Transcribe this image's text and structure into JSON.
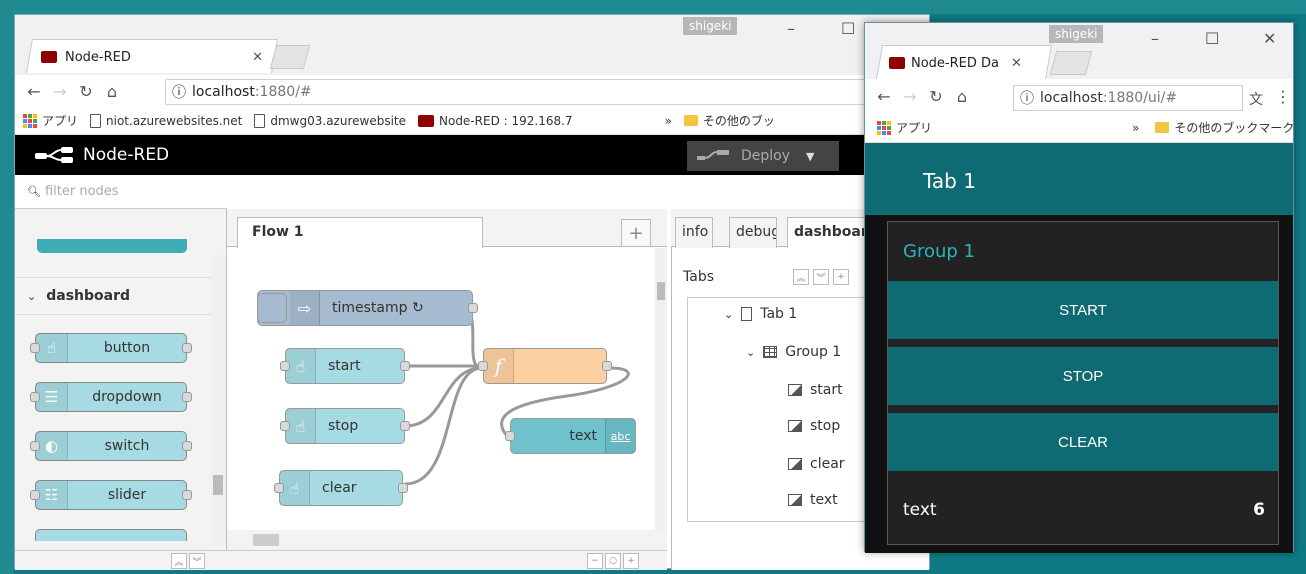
{
  "browser_main": {
    "tab_title": "Node-RED",
    "user_badge": "shigeki",
    "url_host": "localhost",
    "url_rest": ":1880/#",
    "bookmarks": [
      "アプリ",
      "niot.azurewebsites.net",
      "dmwg03.azurewebsite",
      "Node-RED : 192.168.7",
      "その他のブッ"
    ],
    "overflow": "»"
  },
  "node_red": {
    "header_title": "Node-RED",
    "deploy_label": "Deploy",
    "filter_placeholder": "filter nodes",
    "palette_category": "dashboard",
    "palette_nodes": [
      "button",
      "dropdown",
      "switch",
      "slider"
    ],
    "workspace_tab": "Flow 1",
    "flow_nodes": {
      "timestamp": "timestamp ↻",
      "start": "start",
      "stop": "stop",
      "clear": "clear",
      "text": "text",
      "text_badge": "abc",
      "function_icon": "f"
    },
    "sidebar_tabs": [
      "info",
      "debug",
      "dashboard"
    ],
    "sidebar_section": "Tabs",
    "tree": {
      "tab": "Tab 1",
      "group": "Group 1",
      "items": [
        "start",
        "stop",
        "clear",
        "text"
      ]
    }
  },
  "browser_dash": {
    "tab_title": "Node-RED Da",
    "user_badge": "shigeki",
    "url_host": "localhost",
    "url_rest": ":1880/ui/#",
    "bookmark_apps": "アプリ",
    "bookmark_other": "その他のブックマーク",
    "overflow": "»"
  },
  "dashboard": {
    "tab_title": "Tab 1",
    "group_title": "Group 1",
    "buttons": [
      "START",
      "STOP",
      "CLEAR"
    ],
    "text_label": "text",
    "text_value": "6"
  },
  "colors": {
    "desktop": "#0f7a84",
    "dash_teal": "#0e6b73",
    "node_dashboard": "#a6dbe3",
    "node_inject": "#a6bbcf",
    "node_function": "#fdd0a2",
    "group_title": "#2bb3c0"
  }
}
